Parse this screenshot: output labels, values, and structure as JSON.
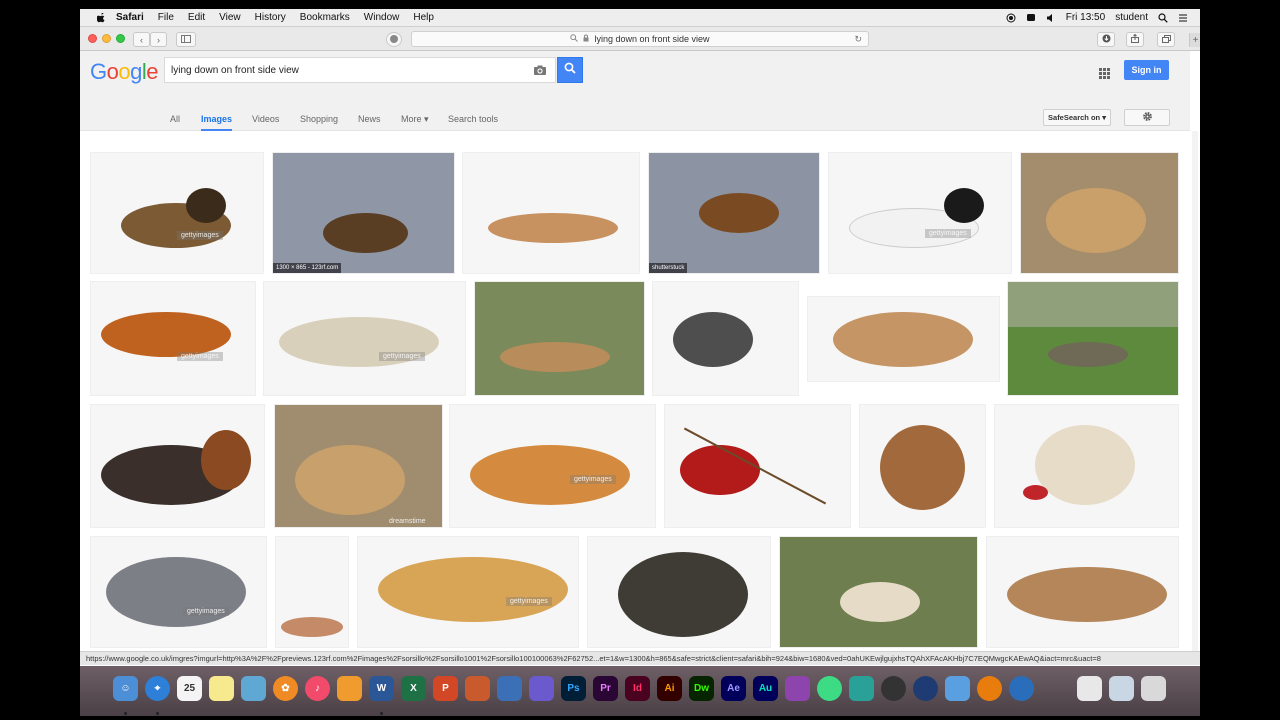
{
  "menubar": {
    "app_name": "Safari",
    "items": [
      "File",
      "Edit",
      "View",
      "History",
      "Bookmarks",
      "Window",
      "Help"
    ],
    "clock": "Fri 13:50",
    "user": "student"
  },
  "browser": {
    "address": "lying down on front side view",
    "status_url": "https://www.google.co.uk/imgres?imgurl=http%3A%2F%2Fpreviews.123rf.com%2Fimages%2Fsorsillo%2Fsorsillo1001%2Fsorsillo100100063%2F62752...et=1&w=1300&h=865&safe=strict&client=safari&bih=924&biw=1680&ved=0ahUKEwjlgujxhsTQAhXFAcAKHbj7C7EQMwgcKAEwAQ&iact=mrc&uact=8"
  },
  "google": {
    "logo_letters": [
      "G",
      "o",
      "o",
      "g",
      "l",
      "e"
    ],
    "query": "lying down on front side view",
    "signin_label": "Sign in",
    "tabs": [
      {
        "label": "All"
      },
      {
        "label": "Images"
      },
      {
        "label": "Videos"
      },
      {
        "label": "Shopping"
      },
      {
        "label": "News"
      },
      {
        "label": "More ▾"
      },
      {
        "label": "Search tools"
      }
    ],
    "safesearch_label": "SafeSearch on ▾"
  },
  "results": {
    "captions": {
      "lion_cub_cat": "1300 × 865 - 123rf.com",
      "shutterstock": "shutterstuck"
    },
    "watermarks": {
      "getty": "gettyimages",
      "dreamstime": "dreamstime"
    }
  },
  "colors": {
    "google_blue": "#4285f4",
    "google_red": "#ea4335",
    "google_yellow": "#fbbc05",
    "google_green": "#34a853"
  }
}
